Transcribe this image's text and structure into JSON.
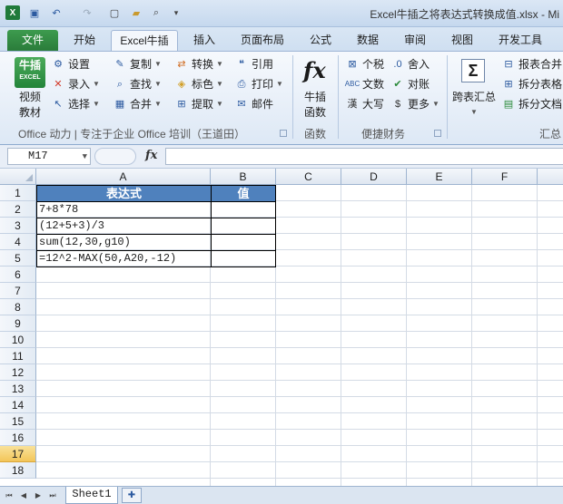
{
  "window": {
    "title": "Excel牛插之将表达式转换成值.xlsx - Mi"
  },
  "ribbon_tabs": [
    "文件",
    "开始",
    "Excel牛插",
    "插入",
    "页面布局",
    "公式",
    "数据",
    "审阅",
    "视图",
    "开发工具"
  ],
  "ribbon": {
    "logo_text": "牛插",
    "logo_sub": "EXCEL",
    "video_label": "视频\n教材",
    "settings": "设置",
    "copy": "复制",
    "convert": "转换",
    "quote": "引用",
    "entry": "录入",
    "find": "查找",
    "color": "标色",
    "print": "打印",
    "select": "选择",
    "merge": "合并",
    "extract": "提取",
    "mail": "邮件",
    "group1_label": "Office 动力 | 专注于企业 Office 培训（王道田）",
    "func_label": "牛插\n函数",
    "func_group_label": "函数",
    "tax": "个税",
    "round_in": "舍入",
    "text": "文数",
    "reconcile": "对账",
    "upper": "大写",
    "more": "更多",
    "fin_group_label": "便捷财务",
    "cross_summary": "跨表汇总",
    "merge_reports": "报表合并",
    "split_tables": "拆分表格",
    "split_docs": "拆分文档",
    "summary_group_label": "汇总"
  },
  "formula_bar": {
    "name_box": "M17",
    "fx": "fx",
    "formula": ""
  },
  "columns": [
    "A",
    "B",
    "C",
    "D",
    "E",
    "F"
  ],
  "rows": [
    "1",
    "2",
    "3",
    "4",
    "5",
    "6",
    "7",
    "8",
    "9",
    "10",
    "11",
    "12",
    "13",
    "14",
    "15",
    "16",
    "17",
    "18"
  ],
  "selected_row": "17",
  "table": {
    "header": {
      "col_a": "表达式",
      "col_b": "值"
    },
    "expressions": [
      "7+8*78",
      "(12+5+3)/3",
      "sum(12,30,g10)",
      "=12^2-MAX(50,A20,-12)"
    ]
  },
  "sheet_tabs": [
    "Sheet1"
  ],
  "colors": {
    "header_fill": "#4f81bd",
    "file_tab": "#2a7c3a",
    "selected_row": "#f3c659"
  }
}
